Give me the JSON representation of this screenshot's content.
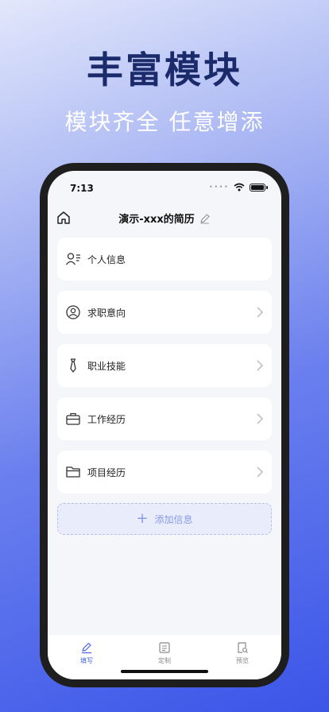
{
  "promo": {
    "title": "丰富模块",
    "subtitle": "模块齐全 任意增添"
  },
  "status_bar": {
    "time": "7:13"
  },
  "nav": {
    "title": "演示-xxx的简历"
  },
  "modules": [
    {
      "label": "个人信息",
      "icon": "person-list-icon",
      "has_chevron": false
    },
    {
      "label": "求职意向",
      "icon": "person-badge-icon",
      "has_chevron": true
    },
    {
      "label": "职业技能",
      "icon": "tie-icon",
      "has_chevron": true
    },
    {
      "label": "工作经历",
      "icon": "briefcase-icon",
      "has_chevron": true
    },
    {
      "label": "项目经历",
      "icon": "folder-icon",
      "has_chevron": true
    }
  ],
  "add_button": {
    "label": "添加信息"
  },
  "tabs": [
    {
      "label": "填写",
      "icon": "pen-icon",
      "active": true
    },
    {
      "label": "定制",
      "icon": "layout-icon",
      "active": false
    },
    {
      "label": "预览",
      "icon": "preview-icon",
      "active": false
    }
  ],
  "colors": {
    "accent": "#4a63e8",
    "headline": "#1b2a6b"
  }
}
